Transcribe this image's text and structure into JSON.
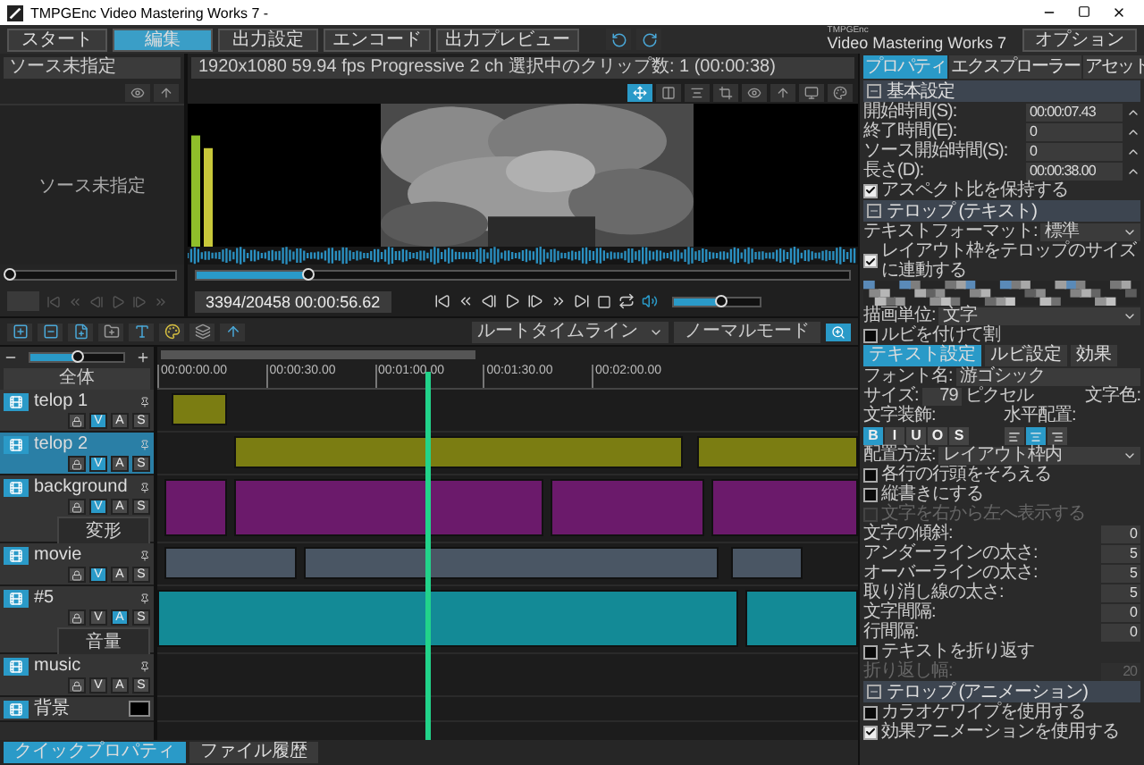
{
  "window": {
    "title": "TMPGEnc Video Mastering Works 7 -"
  },
  "steps": [
    {
      "label": "スタート",
      "selected": false
    },
    {
      "label": "編集",
      "selected": true
    },
    {
      "label": "出力設定",
      "selected": false
    },
    {
      "label": "エンコード",
      "selected": false
    },
    {
      "label": "出力プレビュー",
      "selected": false
    }
  ],
  "logo": {
    "brand": "TMPGEnc",
    "product": "Video Mastering Works 7"
  },
  "options_button": "オプション",
  "source": {
    "field": "ソース未指定",
    "preview_text": "ソース未指定",
    "seek": {
      "level": 0
    }
  },
  "preview": {
    "info": "1920x1080 59.94 fps Progressive 2 ch 選択中のクリップ数: 1 (00:00:38)",
    "seek": {
      "level": 0.17
    },
    "counter": "3394/20458 00:00:56.62",
    "volume": {
      "level": 0.55
    }
  },
  "timeline": {
    "selector": "ルートタイムライン",
    "mode_button": "ノーマルモード",
    "zoom": {
      "level": 0.5
    },
    "fit_button": "全体",
    "ruler": [
      "00:00:00.00",
      "00:00:30.00",
      "00:01:00.00",
      "00:01:30.00",
      "00:02:00.00"
    ],
    "playhead": {
      "level": 0.385
    },
    "tracks": [
      {
        "name": "telop 1",
        "kind": "video",
        "selected": false,
        "color": "#7b7d12",
        "toggles": [
          {
            "label": "V",
            "on": true
          },
          {
            "label": "A",
            "on": false
          },
          {
            "label": "S",
            "on": false
          }
        ]
      },
      {
        "name": "telop 2",
        "kind": "video",
        "selected": true,
        "color": "#7b7d12",
        "toggles": [
          {
            "label": "V",
            "on": true
          },
          {
            "label": "A",
            "on": false
          },
          {
            "label": "S",
            "on": false
          }
        ]
      },
      {
        "name": "background",
        "kind": "video",
        "selected": false,
        "sub": "変形",
        "color": "#6b1a6b",
        "toggles": [
          {
            "label": "V",
            "on": true
          },
          {
            "label": "A",
            "on": false
          },
          {
            "label": "S",
            "on": false
          }
        ]
      },
      {
        "name": "movie",
        "kind": "video",
        "selected": false,
        "color": "#4a5664",
        "toggles": [
          {
            "label": "V",
            "on": true
          },
          {
            "label": "A",
            "on": false
          },
          {
            "label": "S",
            "on": false
          }
        ]
      },
      {
        "name": "#5",
        "kind": "audio",
        "selected": false,
        "sub": "音量",
        "color": "#138a96",
        "toggles": [
          {
            "label": "V",
            "on": false
          },
          {
            "label": "A",
            "on": true
          },
          {
            "label": "S",
            "on": false
          }
        ]
      },
      {
        "name": "music",
        "kind": "audio",
        "selected": false,
        "toggles": [
          {
            "label": "V",
            "on": false
          },
          {
            "label": "A",
            "on": false
          },
          {
            "label": "S",
            "on": false
          }
        ]
      },
      {
        "name": "背景",
        "kind": "background",
        "selected": false,
        "color": "#000000"
      }
    ]
  },
  "bottom_tabs": [
    {
      "label": "クイックプロパティ",
      "selected": true
    },
    {
      "label": "ファイル履歴",
      "selected": false
    }
  ],
  "panel": {
    "tabs": [
      {
        "label": "プロパティ",
        "selected": true
      },
      {
        "label": "エクスプローラー",
        "selected": false
      },
      {
        "label": "アセット",
        "selected": false
      }
    ],
    "rows": [
      {
        "kind": "section",
        "label": "基本設定"
      },
      {
        "kind": "time",
        "label": "開始時間(S):",
        "value": "00:00:07.43"
      },
      {
        "kind": "time",
        "label": "終了時間(E):",
        "value": "0"
      },
      {
        "kind": "time",
        "label": "ソース開始時間(S):",
        "value": "0"
      },
      {
        "kind": "time",
        "label": "長さ(D):",
        "value": "00:00:38.00"
      },
      {
        "kind": "checkbox",
        "label": "アスペクト比を保持する",
        "checked": true,
        "disabled": false
      },
      {
        "kind": "section",
        "label": "テロップ (テキスト)"
      },
      {
        "kind": "select",
        "label": "テキストフォーマット:",
        "value": "標準"
      },
      {
        "kind": "checkbox",
        "label": "レイアウト枠をテロップのサイズに連動する",
        "checked": true,
        "disabled": false
      },
      {
        "kind": "mosaic"
      },
      {
        "kind": "select",
        "label": "描画単位:",
        "value": "文字"
      },
      {
        "kind": "checkbox",
        "label": "ルビを付けて割",
        "checked": false,
        "disabled": false
      },
      {
        "kind": "subtabs",
        "items": [
          {
            "label": "テキスト設定",
            "selected": true
          },
          {
            "label": "ルビ設定",
            "selected": false
          },
          {
            "label": "効果",
            "selected": false
          }
        ]
      },
      {
        "kind": "field",
        "label": "フォント名:",
        "value": "游ゴシック"
      },
      {
        "kind": "size",
        "label": "サイズ:",
        "value": "79",
        "unit": "ピクセル",
        "extra_label": "文字色:"
      },
      {
        "kind": "decor",
        "label": "文字装飾:",
        "buttons": [
          {
            "label": "B",
            "selected": true
          },
          {
            "label": "I",
            "selected": false
          },
          {
            "label": "U",
            "selected": false
          },
          {
            "label": "O",
            "selected": false
          },
          {
            "label": "S",
            "selected": false
          }
        ],
        "align_label": "水平配置:",
        "align": [
          {
            "kind": "left",
            "selected": false
          },
          {
            "kind": "center",
            "selected": true
          },
          {
            "kind": "right",
            "selected": false
          }
        ]
      },
      {
        "kind": "select",
        "label": "配置方法:",
        "value": "レイアウト枠内"
      },
      {
        "kind": "checkbox",
        "label": "各行の行頭をそろえる",
        "checked": false,
        "disabled": false
      },
      {
        "kind": "checkbox",
        "label": "縦書きにする",
        "checked": false,
        "disabled": false
      },
      {
        "kind": "checkbox",
        "label": "文字を右から左へ表示する",
        "checked": false,
        "disabled": true
      },
      {
        "kind": "number",
        "label": "文字の傾斜:",
        "value": "0",
        "disabled": false
      },
      {
        "kind": "number",
        "label": "アンダーラインの太さ:",
        "value": "5",
        "disabled": false
      },
      {
        "kind": "number",
        "label": "オーバーラインの太さ:",
        "value": "5",
        "disabled": false
      },
      {
        "kind": "number",
        "label": "取り消し線の太さ:",
        "value": "5",
        "disabled": false
      },
      {
        "kind": "number",
        "label": "文字間隔:",
        "value": "0",
        "disabled": false
      },
      {
        "kind": "number",
        "label": "行間隔:",
        "value": "0",
        "disabled": false
      },
      {
        "kind": "checkbox",
        "label": "テキストを折り返す",
        "checked": false,
        "disabled": false
      },
      {
        "kind": "number",
        "label": "折り返し幅:",
        "value": "20",
        "disabled": true
      },
      {
        "kind": "section",
        "label": "テロップ (アニメーション)"
      },
      {
        "kind": "checkbox",
        "label": "カラオケワイプを使用する",
        "checked": false,
        "disabled": false
      },
      {
        "kind": "checkbox",
        "label": "効果アニメーションを使用する",
        "checked": true,
        "disabled": false
      }
    ]
  }
}
